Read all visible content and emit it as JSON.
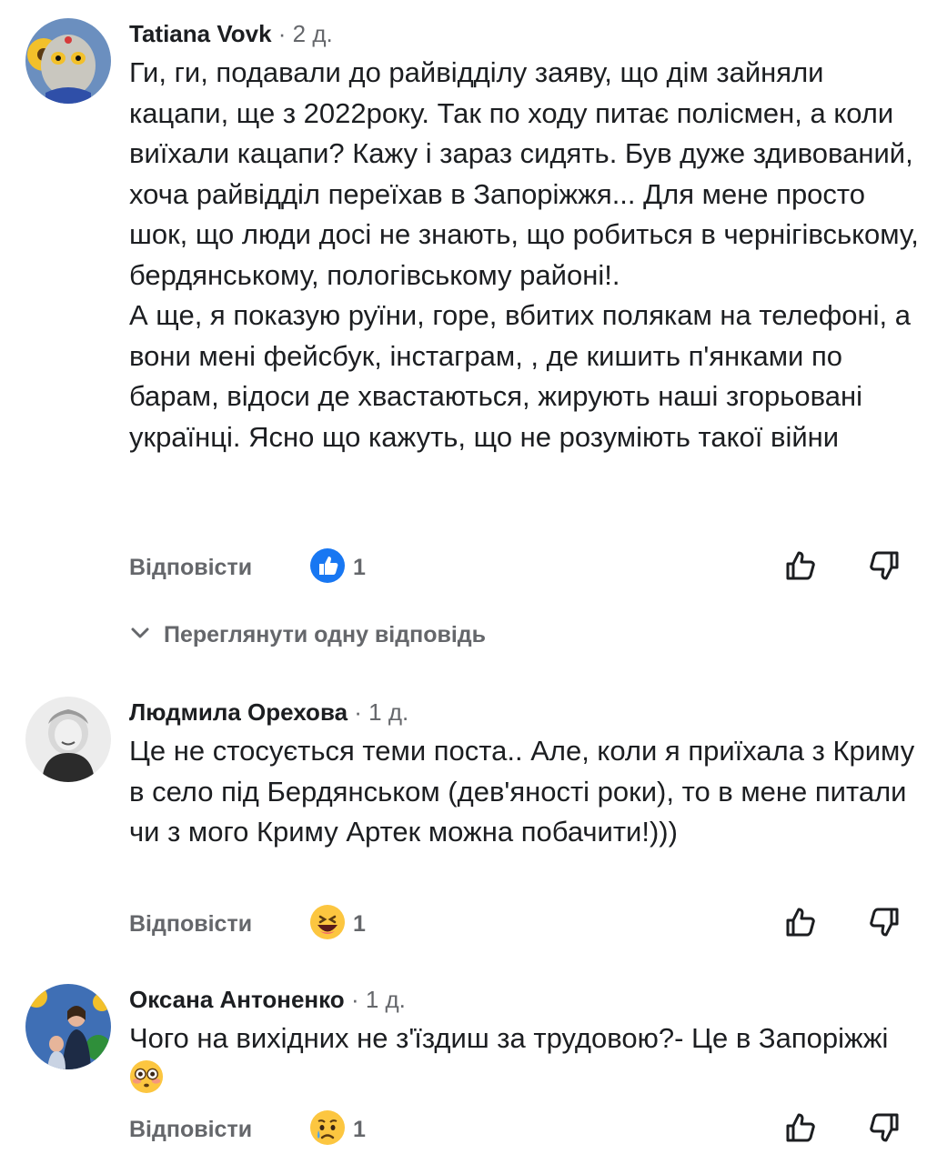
{
  "comments": [
    {
      "author": "Tatiana Vovk",
      "time": "· 2 д.",
      "paragraphs": [
        "Ги, ги, подавали до райвідділу заяву, що дім зайняли кацапи, ще з 2022року. Так по ходу питає полісмен, а коли виїхали кацапи? Кажу і зараз сидять. Був дуже здивований, хоча райвідділ переїхав в Запоріжжя... Для мене просто шок, що люди досі не знають, що робиться в чернігівському, бердянському, пологівському районі!.",
        "А ще, я показую руїни, горе, вбитих  полякам на телефоні, а вони мені фейсбук, інстаграм, , де кишить п'янками по барам, відоси де хвастаються,  жирують наші згорьовані українці. Ясно що кажуть, що не розуміють такої війни"
      ],
      "reply_label": "Відповісти",
      "reaction_icon": "like-reaction-icon",
      "reaction_count": "1",
      "view_replies_label": "Переглянути одну відповідь"
    },
    {
      "author": "Людмила Орехова",
      "time": "· 1 д.",
      "paragraphs": [
        "Це не стосується теми поста..  Але, коли я приїхала з Криму в село під Бердянськом (дев'яності роки), то в мене питали чи з мого Криму Артек можна побачити!)))"
      ],
      "reply_label": "Відповісти",
      "reaction_icon": "haha-reaction-icon",
      "reaction_count": "1"
    },
    {
      "author": "Оксана Антоненко",
      "time": "· 1 д.",
      "paragraphs": [
        "Чого на вихідних не з'їздиш за трудовою?- Це в Запоріжжі"
      ],
      "inline_emoji": "flushed-face-emoji",
      "reply_label": "Відповісти",
      "reaction_icon": "sad-reaction-icon",
      "reaction_count": "1"
    }
  ],
  "colors": {
    "text": "#1c1e21",
    "secondary": "#65676b",
    "like_blue": "#1877f2",
    "emoji_yellow": "#fcc640"
  }
}
